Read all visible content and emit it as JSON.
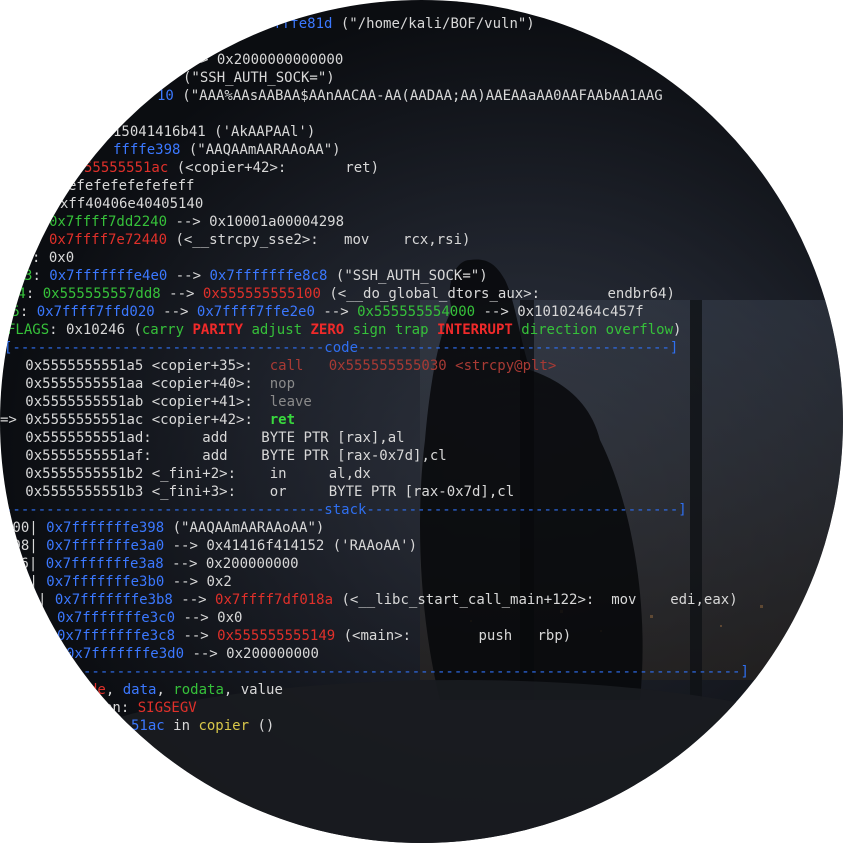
{
  "registers": {
    "r1": {
      "addr": "ffffe81d",
      "rest": " (\"/home/kali/BOF/vuln\")"
    },
    "r2": {
      "text": "> 0x2000000000000"
    },
    "r3": {
      "text": "(\"SSH_AUTH_SOCK=\")"
    },
    "r4": {
      "addr": "10",
      "rest": " (\"AAA%AAsAABAA$AAnAACAA-AA(AADAA;AA)AAEAAaAA0AAFAAbAA1AAG"
    },
    "r5": {
      "text": "A\")"
    },
    "r6": {
      "text": "15041416b41 ('AkAAPAAl')"
    },
    "r7": {
      "addr": "ffffe398",
      "rest": " (\"AAQAAmAARAAoAA\")"
    },
    "r8": {
      "addr": "55555551ac",
      "rest": " (<copier+42>:       ret)"
    },
    "r9": {
      "text": "efefefefefefeff"
    },
    "r10": {
      "text": "xff40406e40405140"
    },
    "r11": {
      "addr": "0x7ffff7dd2240",
      "rest": " --> 0x10001a00004298"
    },
    "r12": {
      "addr": "0x7ffff7e72440",
      "rest": " (<__strcpy_sse2>:   mov    rcx,rsi)"
    },
    "r13": {
      "prefix": ": ",
      "text": "0x0"
    },
    "r14": {
      "prefix": "3",
      "p2": ": ",
      "a1": "0x7fffffffe4e0",
      "m": " --> ",
      "a2": "0x7fffffffe8c8",
      "rest": " (\"SSH_AUTH_SOCK=\")"
    },
    "r15": {
      "prefix": "14",
      "p2": ": ",
      "a1": "0x555555557dd8",
      "m": " --> ",
      "a2": "0x555555555100",
      "rest": " (<__do_global_dtors_aux>:        endbr64)"
    },
    "r16": {
      "prefix": "15",
      "p2": ": ",
      "a1": "0x7ffff7ffd020",
      "m": " --> ",
      "a2": "0x7ffff7ffe2e0",
      "m2": " --> ",
      "a3": "0x555555554000",
      "rest": " --> 0x10102464c457f"
    },
    "eflags": {
      "label": "FLAGS",
      "value": ": 0x10246 (",
      "carry": "carry",
      "parity": "PARITY",
      "adjust": "adjust",
      "zero": "ZERO",
      "sign": "sign",
      "trap": "trap",
      "interrupt": "INTERRUPT",
      "direction": "direction",
      "overflow": "overflow",
      "close": ")"
    }
  },
  "code_separator": "[-------------------------------------code-------------------------------------]",
  "code": [
    {
      "addr": "   0x5555555551a5 <copier+35>:  ",
      "op": "call   0x555555555030 <strcpy@plt>"
    },
    {
      "addr": "   0x5555555551aa <copier+40>:  ",
      "op": "nop"
    },
    {
      "addr": "   0x5555555551ab <copier+41>:  ",
      "op": "leave"
    },
    {
      "arrow": "=> ",
      "addr": "0x5555555551ac <copier+42>:  ",
      "op": "ret"
    },
    {
      "addr": "   0x5555555551ad:      ",
      "op": "add    BYTE PTR [rax],al"
    },
    {
      "addr": "   0x5555555551af:      ",
      "op": "add    BYTE PTR [rax-0x7d],cl"
    },
    {
      "addr": "   0x5555555551b2 <_fini+2>:    ",
      "op": "in     al,dx"
    },
    {
      "addr": "   0x5555555551b3 <_fini+3>:    ",
      "op": "or     BYTE PTR [rax-0x7d],cl"
    }
  ],
  "stack_separator": "--------------------------------------stack-------------------------------------]",
  "stack": [
    {
      "idx": "000| ",
      "addr": "0x7fffffffe398",
      "rest": " (\"AAQAAmAARAAoAA\")"
    },
    {
      "idx": "008| ",
      "addr": "0x7fffffffe3a0",
      "rest": " --> 0x41416f414152 ('RAAoAA')"
    },
    {
      "idx": "16| ",
      "addr": "0x7fffffffe3a8",
      "rest": " --> 0x200000000"
    },
    {
      "idx": "4| ",
      "addr": "0x7fffffffe3b0",
      "rest": " --> 0x2"
    },
    {
      "idx": "| ",
      "addr": "0x7fffffffe3b8",
      "mid": " --> ",
      "addr2": "0x7ffff7df018a",
      "rest": " (<__libc_start_call_main+122>:  mov    edi,eax)"
    },
    {
      "idx": "",
      "addr": "0x7fffffffe3c0",
      "rest": " --> 0x0"
    },
    {
      "idx": "",
      "addr": "0x7fffffffe3c8",
      "mid": " --> ",
      "addr2": "0x555555555149",
      "rest": " (<main>:        push   rbp)"
    },
    {
      "idx": "",
      "addr": "0x7fffffffe3d0",
      "rest": " --> 0x200000000"
    }
  ],
  "bottom_separator": "------------------------------------------------------------------------------]",
  "legend": {
    "code": "de",
    "c1": ", ",
    "data": "data",
    "c2": ", ",
    "rodata": "rodata",
    "c3": ", ",
    "value": "value"
  },
  "signal": {
    "label": "on: ",
    "value": "SIGSEGV"
  },
  "stopped": {
    "addr": "51ac",
    "mid": " in ",
    "func": "copier",
    "rest": " ()"
  }
}
